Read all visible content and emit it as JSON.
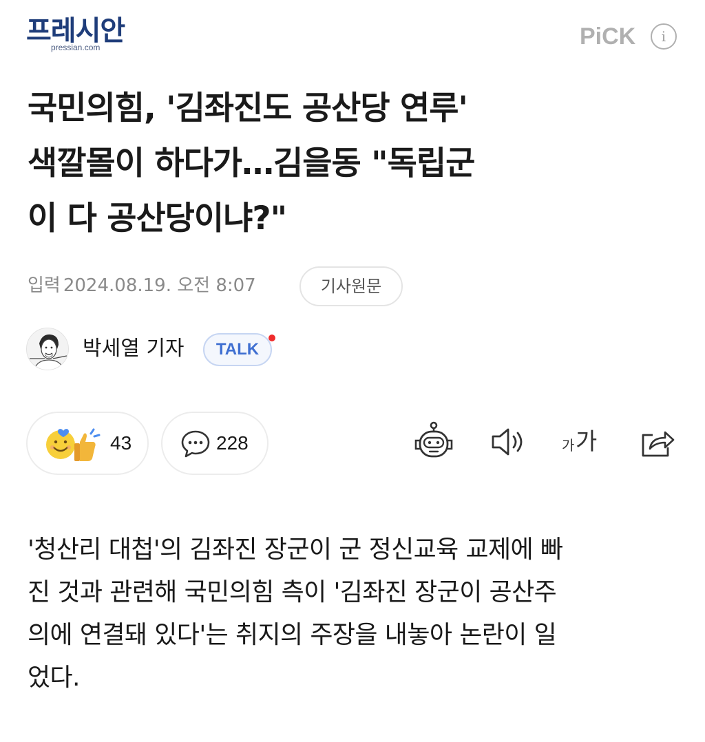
{
  "header": {
    "logo_text": "프레시안",
    "logo_sub": "pressian.com",
    "pick_label": "PiCK",
    "info_glyph": "i"
  },
  "article": {
    "title_lines": [
      "국민의힘, '김좌진도 공산당 연루'",
      "색깔몰이 하다가…김을동 \"독립군",
      "이 다 공산당이냐?\""
    ],
    "date_label": "입력",
    "date_value": "2024.08.19. 오전 8:07",
    "original_button": "기사원문",
    "author_name": "박세열 기자",
    "talk_label": "TALK",
    "body_lines": [
      "'청산리 대첩'의 김좌진 장군이 군 정신교육 교제에 빠",
      "진 것과 관련해 국민의힘 측이 '김좌진 장군이 공산주",
      "의에 연결돼 있다'는 취지의 주장을 내놓아 논란이 일",
      "었다."
    ]
  },
  "actions": {
    "reaction_count": "43",
    "comment_count": "228",
    "font_size_small": "가",
    "font_size_large": "가",
    "icons": [
      "reaction-emoji-icon",
      "comment-icon",
      "ai-summary-robot-icon",
      "speaker-icon",
      "font-size-icon",
      "share-icon"
    ]
  },
  "colors": {
    "brand": "#1f3d7a",
    "talk": "#3f6fd1",
    "talk_dot": "#ef2b2b",
    "muted": "#8a8a8a"
  }
}
